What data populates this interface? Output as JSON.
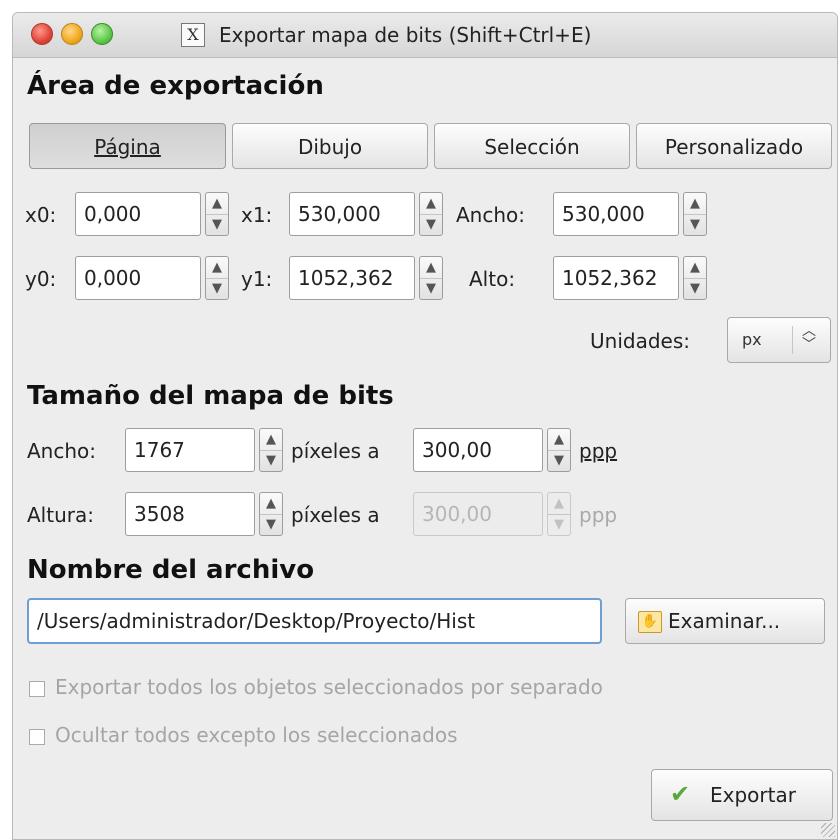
{
  "window": {
    "title": "Exportar mapa de bits (Shift+Ctrl+E)",
    "app_icon": "X"
  },
  "export_area": {
    "heading": "Área de exportación",
    "buttons": [
      "Página",
      "Dibujo",
      "Selección",
      "Personalizado"
    ],
    "selected": "Página",
    "x0": {
      "label": "x0:",
      "value": "0,000"
    },
    "x1": {
      "label": "x1:",
      "value": "530,000"
    },
    "width": {
      "label": "Ancho:",
      "value": "530,000"
    },
    "y0": {
      "label": "y0:",
      "value": "0,000"
    },
    "y1": {
      "label": "y1:",
      "value": "1052,362"
    },
    "height": {
      "label": "Alto:",
      "value": "1052,362"
    },
    "units": {
      "label": "Unidades:",
      "value": "px"
    }
  },
  "bitmap_size": {
    "heading": "Tamaño del mapa de bits",
    "width": {
      "label": "Ancho:",
      "value": "1767",
      "unit_text": "píxeles a",
      "dpi": "300,00",
      "dpi_unit": "ppp"
    },
    "height": {
      "label": "Altura:",
      "value": "3508",
      "unit_text": "píxeles a",
      "dpi": "300,00",
      "dpi_unit": "ppp"
    }
  },
  "filename": {
    "heading": "Nombre del archivo",
    "value": "/Users/administrador/Desktop/Proyecto/Hist",
    "browse_label": "Examinar..."
  },
  "options": {
    "batch_export": "Exportar todos los objetos seleccionados por separado",
    "hide_others": "Ocultar todos excepto los seleccionados"
  },
  "export_button": "Exportar"
}
